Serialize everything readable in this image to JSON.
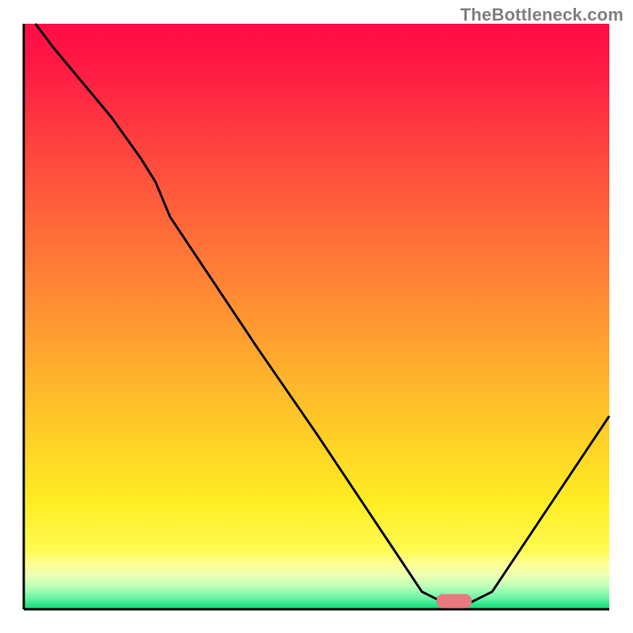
{
  "attribution": "TheBottleneck.com",
  "chart_data": {
    "type": "line",
    "title": "",
    "xlabel": "",
    "ylabel": "",
    "xlim": [
      0,
      100
    ],
    "ylim": [
      0,
      100
    ],
    "x": [
      2,
      5,
      10,
      15,
      20,
      22.5,
      25,
      30,
      40,
      50,
      60,
      65,
      68,
      72,
      76,
      80,
      85,
      90,
      95,
      100
    ],
    "values": [
      100,
      96,
      90,
      84,
      77,
      73,
      67,
      59.5,
      44.5,
      30,
      15,
      7.5,
      3,
      1,
      1,
      3,
      10.5,
      18,
      25.5,
      33
    ],
    "marker": {
      "x": 73.5,
      "y": 1.4,
      "width": 6,
      "height": 2.4
    },
    "background_gradient_stops": [
      {
        "pos": 0.0,
        "color": "#ff0b46"
      },
      {
        "pos": 0.08,
        "color": "#ff1c44"
      },
      {
        "pos": 0.18,
        "color": "#ff3a40"
      },
      {
        "pos": 0.3,
        "color": "#ff5c3b"
      },
      {
        "pos": 0.42,
        "color": "#ff7e36"
      },
      {
        "pos": 0.52,
        "color": "#ff9a31"
      },
      {
        "pos": 0.62,
        "color": "#ffb72b"
      },
      {
        "pos": 0.72,
        "color": "#ffd326"
      },
      {
        "pos": 0.82,
        "color": "#ffee24"
      },
      {
        "pos": 0.9,
        "color": "#fffb52"
      },
      {
        "pos": 0.92,
        "color": "#ffff90"
      },
      {
        "pos": 0.94,
        "color": "#f0ffb0"
      },
      {
        "pos": 0.96,
        "color": "#c0ffb8"
      },
      {
        "pos": 0.98,
        "color": "#70f5a8"
      },
      {
        "pos": 1.0,
        "color": "#00e070"
      }
    ],
    "axis_color": "#000000",
    "line_color": "#000000",
    "marker_color": "#e97880"
  }
}
